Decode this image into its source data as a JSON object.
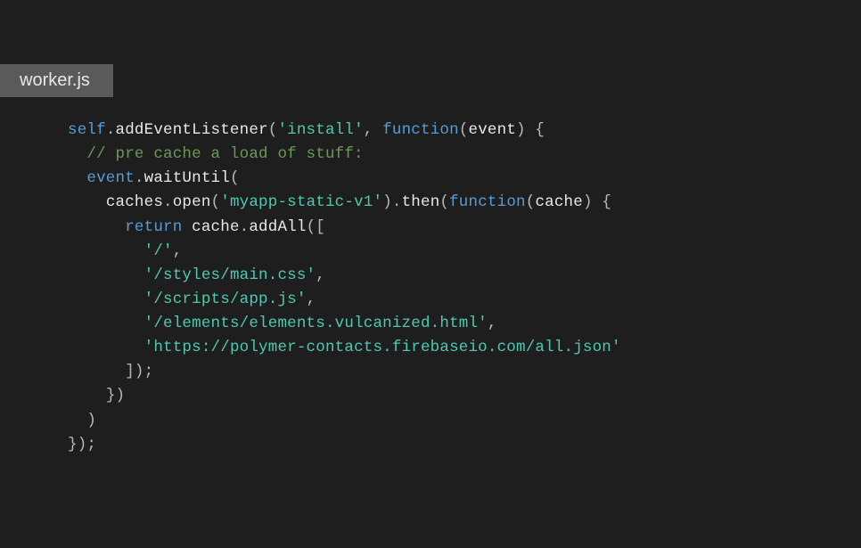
{
  "tab": {
    "filename": "worker.js"
  },
  "code": {
    "lines": [
      {
        "indent": 0,
        "tokens": [
          {
            "t": "self",
            "c": "kw"
          },
          {
            "t": ".",
            "c": "punct"
          },
          {
            "t": "addEventListener",
            "c": "ident"
          },
          {
            "t": "(",
            "c": "paren"
          },
          {
            "t": "'install'",
            "c": "str"
          },
          {
            "t": ", ",
            "c": "punct"
          },
          {
            "t": "function",
            "c": "kw"
          },
          {
            "t": "(",
            "c": "paren"
          },
          {
            "t": "event",
            "c": "ident"
          },
          {
            "t": ") {",
            "c": "paren"
          }
        ]
      },
      {
        "indent": 1,
        "tokens": [
          {
            "t": "// pre cache a load of stuff:",
            "c": "comment"
          }
        ]
      },
      {
        "indent": 1,
        "tokens": [
          {
            "t": "event",
            "c": "kw"
          },
          {
            "t": ".",
            "c": "punct"
          },
          {
            "t": "waitUntil",
            "c": "ident"
          },
          {
            "t": "(",
            "c": "paren"
          }
        ]
      },
      {
        "indent": 2,
        "tokens": [
          {
            "t": "caches",
            "c": "ident"
          },
          {
            "t": ".",
            "c": "punct"
          },
          {
            "t": "open",
            "c": "ident"
          },
          {
            "t": "(",
            "c": "paren"
          },
          {
            "t": "'myapp-static-v1'",
            "c": "str"
          },
          {
            "t": ")",
            "c": "paren"
          },
          {
            "t": ".",
            "c": "punct"
          },
          {
            "t": "then",
            "c": "ident"
          },
          {
            "t": "(",
            "c": "paren"
          },
          {
            "t": "function",
            "c": "kw"
          },
          {
            "t": "(",
            "c": "paren"
          },
          {
            "t": "cache",
            "c": "ident"
          },
          {
            "t": ") {",
            "c": "paren"
          }
        ]
      },
      {
        "indent": 3,
        "tokens": [
          {
            "t": "return",
            "c": "kw"
          },
          {
            "t": " ",
            "c": "punct"
          },
          {
            "t": "cache",
            "c": "ident"
          },
          {
            "t": ".",
            "c": "punct"
          },
          {
            "t": "addAll",
            "c": "ident"
          },
          {
            "t": "([",
            "c": "paren"
          }
        ]
      },
      {
        "indent": 4,
        "tokens": [
          {
            "t": "'/'",
            "c": "str"
          },
          {
            "t": ",",
            "c": "punct"
          }
        ]
      },
      {
        "indent": 4,
        "tokens": [
          {
            "t": "'/styles/main.css'",
            "c": "str"
          },
          {
            "t": ",",
            "c": "punct"
          }
        ]
      },
      {
        "indent": 4,
        "tokens": [
          {
            "t": "'/scripts/app.js'",
            "c": "str"
          },
          {
            "t": ",",
            "c": "punct"
          }
        ]
      },
      {
        "indent": 4,
        "tokens": [
          {
            "t": "'/elements/elements.vulcanized.html'",
            "c": "str"
          },
          {
            "t": ",",
            "c": "punct"
          }
        ]
      },
      {
        "indent": 4,
        "tokens": [
          {
            "t": "'https://polymer-contacts.firebaseio.com/all.json'",
            "c": "str"
          }
        ]
      },
      {
        "indent": 3,
        "tokens": [
          {
            "t": "]);",
            "c": "paren"
          }
        ]
      },
      {
        "indent": 2,
        "tokens": [
          {
            "t": "})",
            "c": "paren"
          }
        ]
      },
      {
        "indent": 1,
        "tokens": [
          {
            "t": ")",
            "c": "paren"
          }
        ]
      },
      {
        "indent": 0,
        "tokens": [
          {
            "t": "});",
            "c": "paren"
          }
        ]
      }
    ]
  }
}
